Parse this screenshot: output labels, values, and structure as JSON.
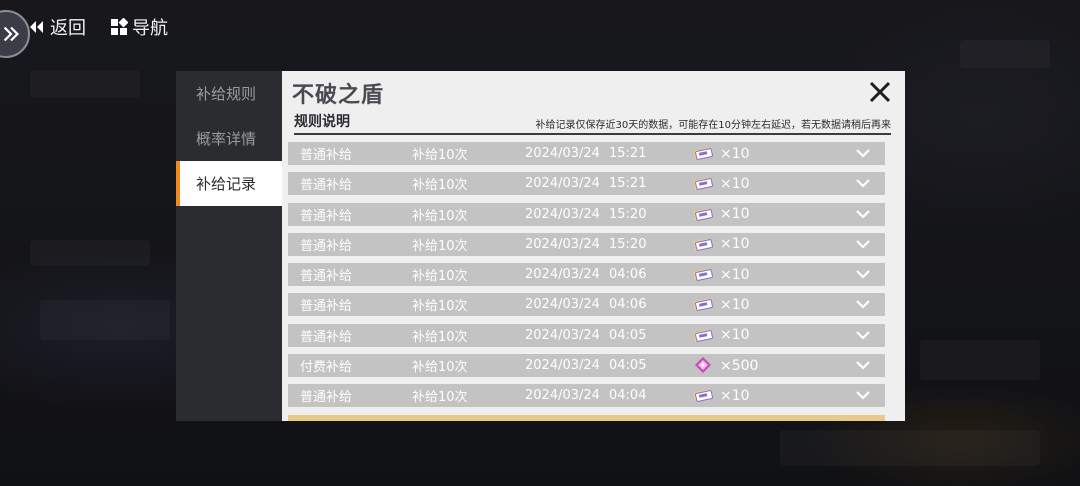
{
  "topbar": {
    "back_label": "返回",
    "nav_label": "导航"
  },
  "tabs": [
    {
      "label": "补给规则",
      "active": false
    },
    {
      "label": "概率详情",
      "active": false
    },
    {
      "label": "补给记录",
      "active": true
    }
  ],
  "panel": {
    "title": "不破之盾",
    "rules_label": "规则说明",
    "rules_note": "补给记录仅保存近30天的数据，可能存在10分钟左右延迟，若无数据请稍后再来"
  },
  "records": [
    {
      "type": "普通补给",
      "count": "补给10次",
      "date": "2024/03/24",
      "time": "15:21",
      "icon": "ticket-icon",
      "qty": "×10"
    },
    {
      "type": "普通补给",
      "count": "补给10次",
      "date": "2024/03/24",
      "time": "15:21",
      "icon": "ticket-icon",
      "qty": "×10"
    },
    {
      "type": "普通补给",
      "count": "补给10次",
      "date": "2024/03/24",
      "time": "15:20",
      "icon": "ticket-icon",
      "qty": "×10"
    },
    {
      "type": "普通补给",
      "count": "补给10次",
      "date": "2024/03/24",
      "time": "15:20",
      "icon": "ticket-icon",
      "qty": "×10"
    },
    {
      "type": "普通补给",
      "count": "补给10次",
      "date": "2024/03/24",
      "time": "04:06",
      "icon": "ticket-icon",
      "qty": "×10"
    },
    {
      "type": "普通补给",
      "count": "补给10次",
      "date": "2024/03/24",
      "time": "04:06",
      "icon": "ticket-icon",
      "qty": "×10"
    },
    {
      "type": "普通补给",
      "count": "补给10次",
      "date": "2024/03/24",
      "time": "04:05",
      "icon": "ticket-icon",
      "qty": "×10"
    },
    {
      "type": "付费补给",
      "count": "补给10次",
      "date": "2024/03/24",
      "time": "04:05",
      "icon": "crystal-icon",
      "qty": "×500"
    },
    {
      "type": "普通补给",
      "count": "补给10次",
      "date": "2024/03/24",
      "time": "04:04",
      "icon": "ticket-icon",
      "qty": "×10"
    }
  ],
  "colors": {
    "accent": "#f08a1c",
    "row_bg": "#c3c3c3",
    "partial_row_bg": "#e9c98a",
    "panel_bg": "#efefef",
    "sidebar_bg": "#2b2c30"
  }
}
